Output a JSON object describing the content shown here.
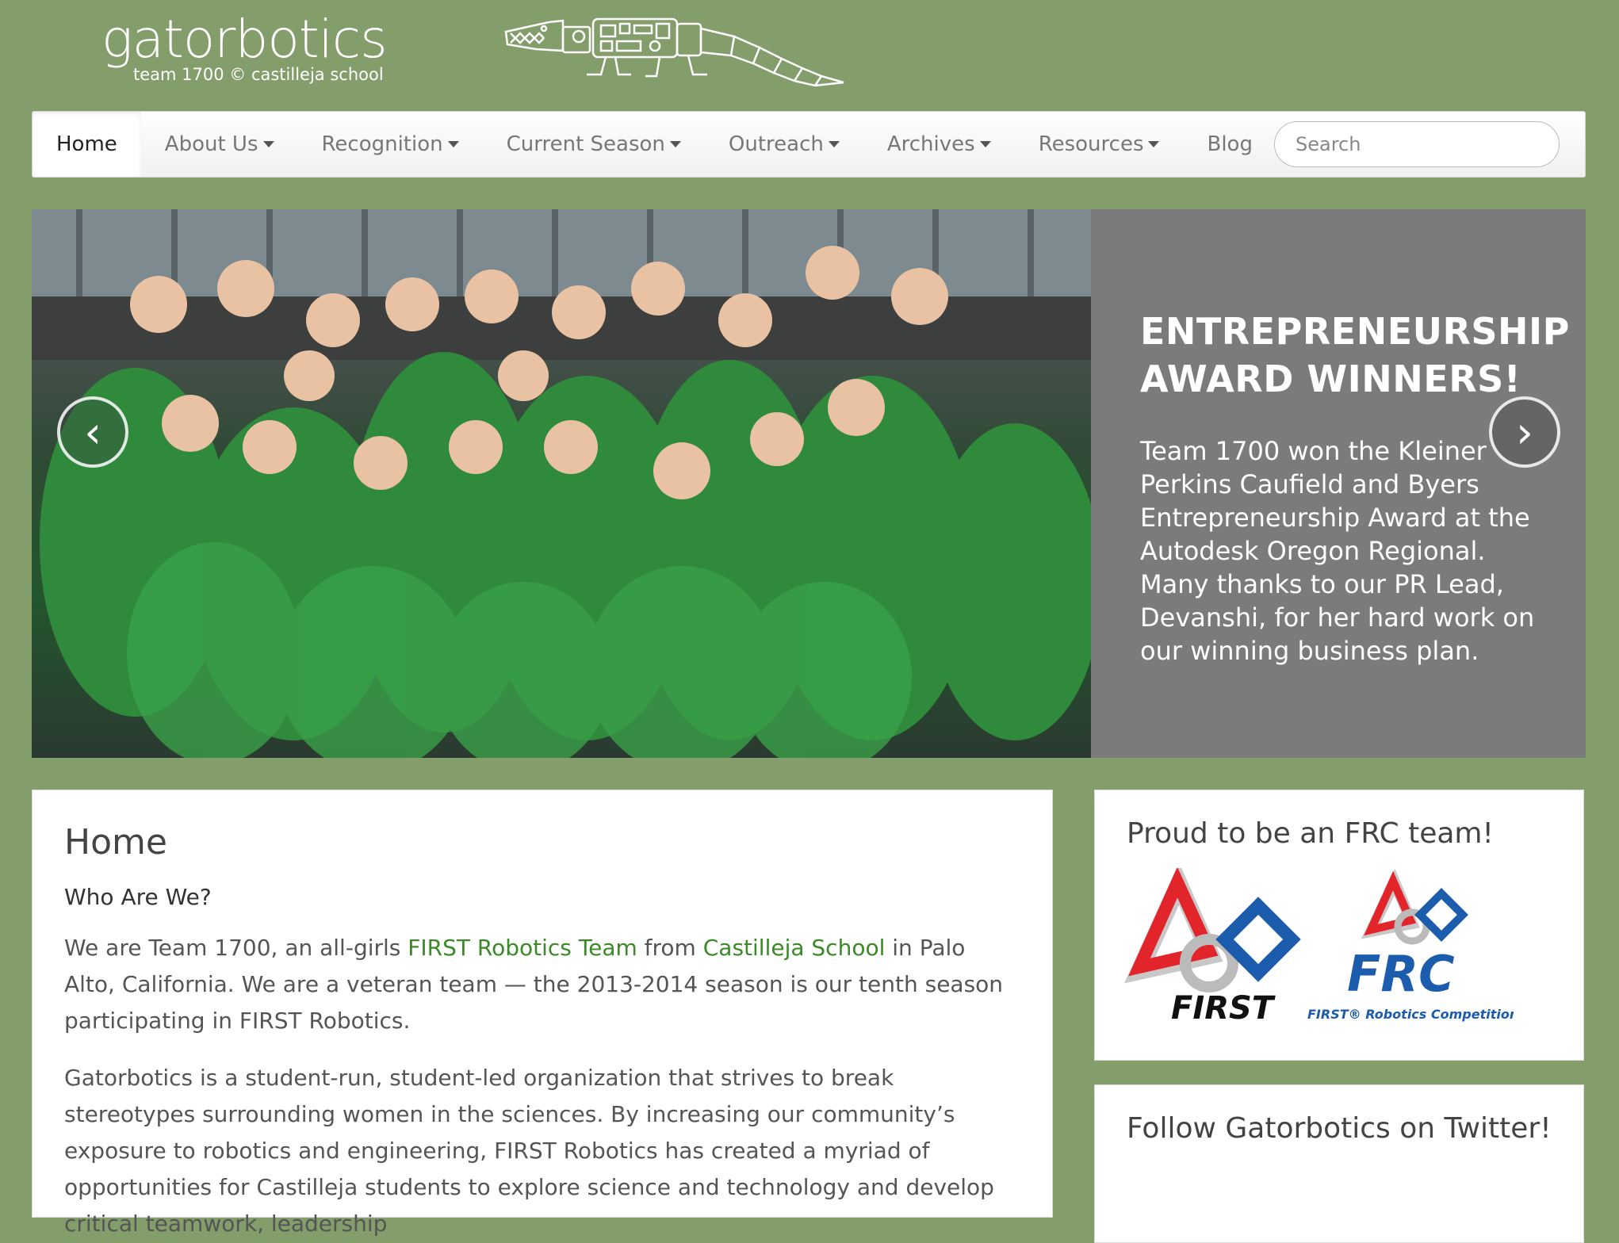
{
  "brand": {
    "name": "gatorbotics",
    "subtitle": "team 1700 © castilleja school"
  },
  "nav": {
    "items": [
      {
        "label": "Home"
      },
      {
        "label": "About Us"
      },
      {
        "label": "Recognition"
      },
      {
        "label": "Current Season"
      },
      {
        "label": "Outreach"
      },
      {
        "label": "Archives"
      },
      {
        "label": "Resources"
      },
      {
        "label": "Blog"
      }
    ],
    "search_placeholder": "Search"
  },
  "carousel": {
    "title": "ENTREPRENEURSHIP AWARD WINNERS!",
    "text": "Team 1700 won the Kleiner Perkins Caufield and Byers Entrepreneurship Award at the Autodesk Oregon Regional. Many thanks to our PR Lead, Devanshi, for her hard work on our winning business plan.",
    "prev_symbol": "‹",
    "next_symbol": "›"
  },
  "main": {
    "heading": "Home",
    "subheading": "Who Are We?",
    "p1_a": "We are Team 1700, an all-girls ",
    "p1_link1": "FIRST Robotics Team",
    "p1_b": " from ",
    "p1_link2": "Castilleja School",
    "p1_c": " in Palo Alto, California. We are a veteran team — the 2013-2014 season is our tenth season participating in FIRST Robotics.",
    "p2": "Gatorbotics is a student-run, student-led organization that strives to break stereotypes surrounding women in the sciences. By increasing our community’s exposure to robotics and engineering, FIRST Robotics has created a myriad of opportunities for Castilleja students to explore science and technology and develop critical teamwork, leadership"
  },
  "sidebar": {
    "widget1_title": "Proud to be an FRC team!",
    "first_logo_text": "FIRST",
    "frc_logo_text": "FRC",
    "frc_logo_sub": "FIRST® Robotics Competition",
    "widget2_title": "Follow Gatorbotics on Twitter!"
  },
  "colors": {
    "background": "#839d6b",
    "link": "#3a8a27",
    "caption_bg": "#7b7b7b",
    "first_red": "#e2242b",
    "first_blue": "#1c5cad"
  }
}
